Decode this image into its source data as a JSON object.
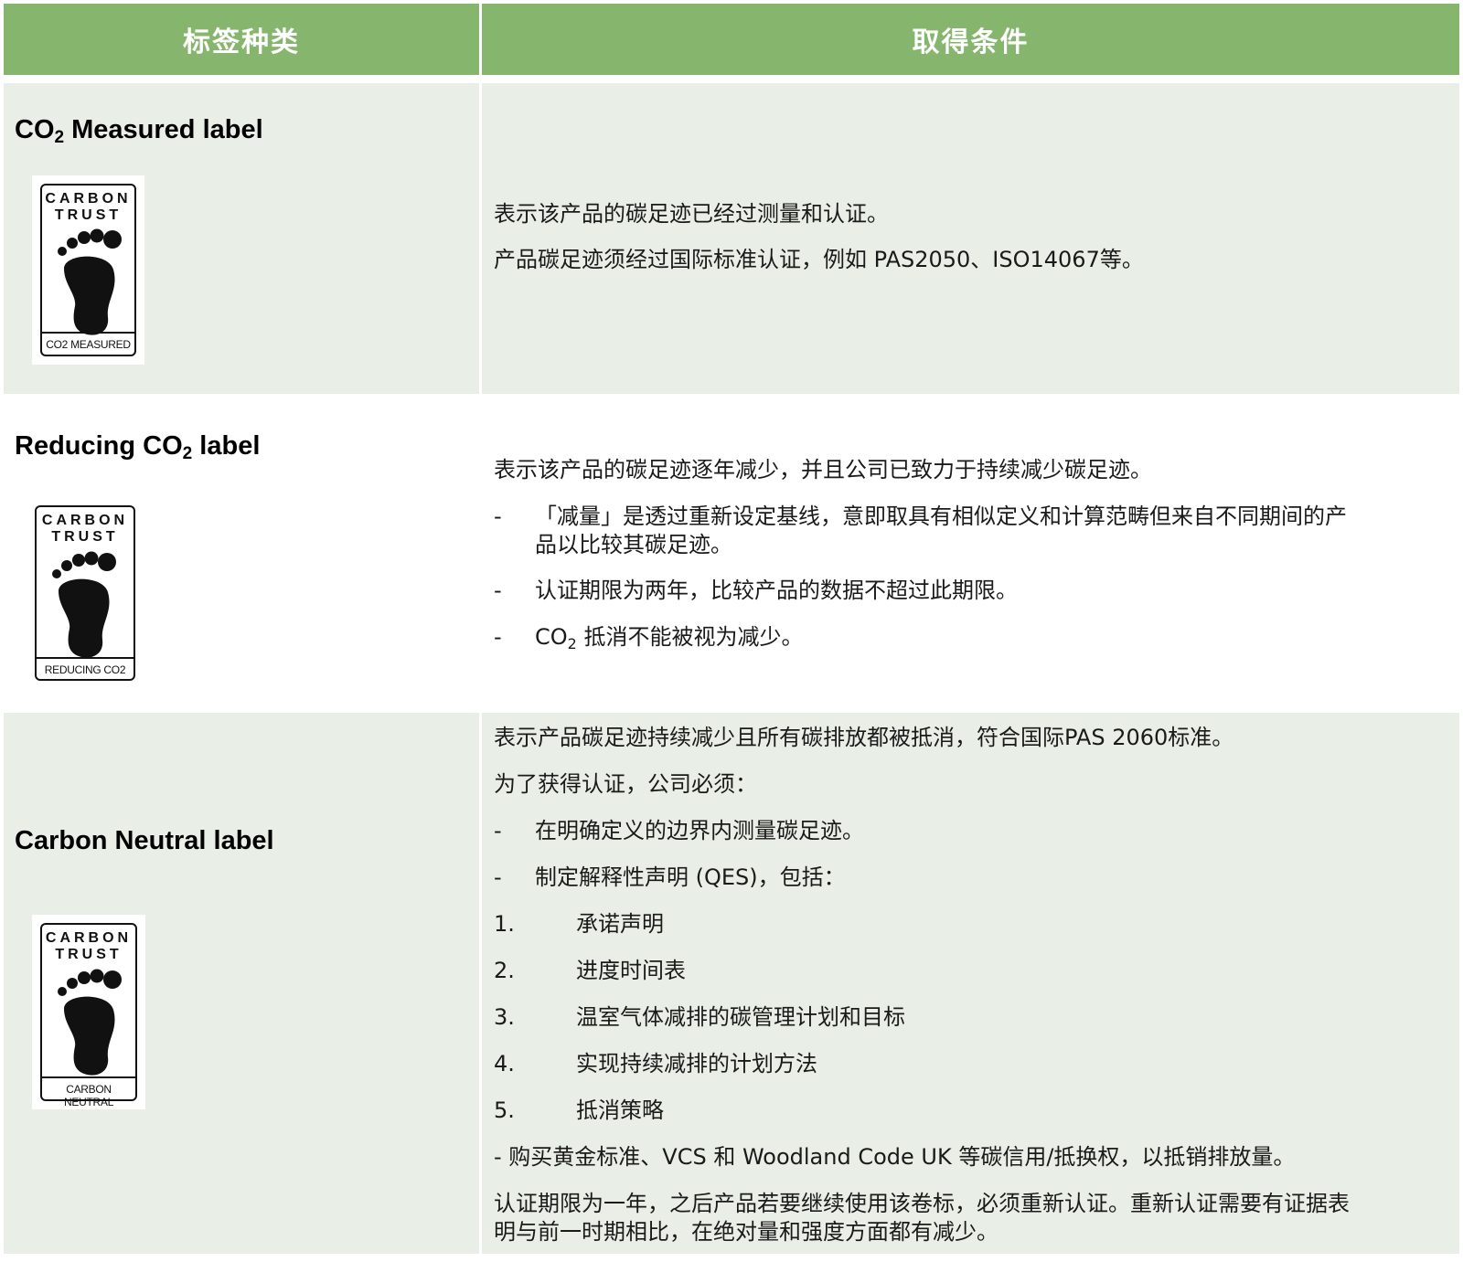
{
  "header": {
    "col_type": "标签种类",
    "col_condition": "取得条件"
  },
  "rows": [
    {
      "title_pre": "CO",
      "title_sub": "2",
      "title_post": " Measured label",
      "badge": {
        "line1": "CARBON",
        "line2": "TRUST",
        "caption": "CO2 MEASURED",
        "icon": "footprint-icon"
      },
      "lines": [
        "表示该产品的碳足迹已经过测量和认证。",
        "产品碳足迹须经过国际标准认证，例如 PAS2050、ISO14067等。"
      ]
    },
    {
      "title_pre": "Reducing CO",
      "title_sub": "2",
      "title_post": " label",
      "badge": {
        "line1": "CARBON",
        "line2": "TRUST",
        "caption": "REDUCING CO2",
        "icon": "footprint-icon"
      },
      "intro": "表示该产品的碳足迹逐年减少，并且公司已致力于持续减少碳足迹。",
      "bullet_marker": "-",
      "bullets": [
        {
          "line1": "「减量」是透过重新设定基线，意即取具有相似定义和计算范畴但来自不同期间的产",
          "line2": "品以比较其碳足迹。"
        },
        {
          "line1": "认证期限为两年，比较产品的数据不超过此期限。"
        },
        {
          "pre": "CO",
          "sub": "2",
          "post": " 抵消不能被视为减少。"
        }
      ]
    },
    {
      "title": "Carbon Neutral label",
      "badge": {
        "line1": "CARBON",
        "line2": "TRUST",
        "caption": "CARBON NEUTRAL",
        "icon": "footprint-icon"
      },
      "intro": "表示产品碳足迹持续减少且所有碳排放都被抵消，符合国际PAS 2060标准。",
      "must": "为了获得认证，公司必须：",
      "bullet_marker": "-",
      "bullets": [
        "在明确定义的边界内测量碳足迹。",
        "制定解释性声明 (QES)，包括："
      ],
      "numbered": [
        {
          "n": "1.",
          "text": "承诺声明"
        },
        {
          "n": "2.",
          "text": "进度时间表"
        },
        {
          "n": "3.",
          "text": "温室气体减排的碳管理计划和目标"
        },
        {
          "n": "4.",
          "text": "实现持续减排的计划方法"
        },
        {
          "n": "5.",
          "text": "抵消策略"
        }
      ],
      "purchase": "- 购买黄金标准、VCS 和 Woodland Code UK 等碳信用/抵换权，以抵销排放量。",
      "validity_line1": "认证期限为一年，之后产品若要继续使用该卷标，必须重新认证。重新认证需要有证据表",
      "validity_line2": "明与前一时期相比，在绝对量和强度方面都有减少。"
    }
  ],
  "colors": {
    "header_bg": "#86b56d",
    "band_bg": "#e9efe6"
  }
}
